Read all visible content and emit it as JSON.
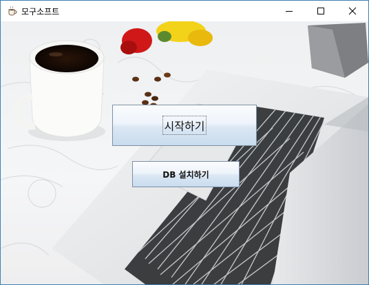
{
  "window": {
    "title": "모구소프트",
    "app_icon": "coffee-cup-icon"
  },
  "titlebar_buttons": {
    "minimize": "minimize-icon",
    "maximize": "maximize-icon",
    "close": "close-icon"
  },
  "main": {
    "start_label": "시작하기",
    "db_install_label": "DB 설치하기"
  },
  "colors": {
    "window_border": "#3c7fb1",
    "button_border": "#7c8ea4",
    "button_gradient_top": "#fafcfe",
    "button_gradient_bottom": "#c8dcee"
  }
}
